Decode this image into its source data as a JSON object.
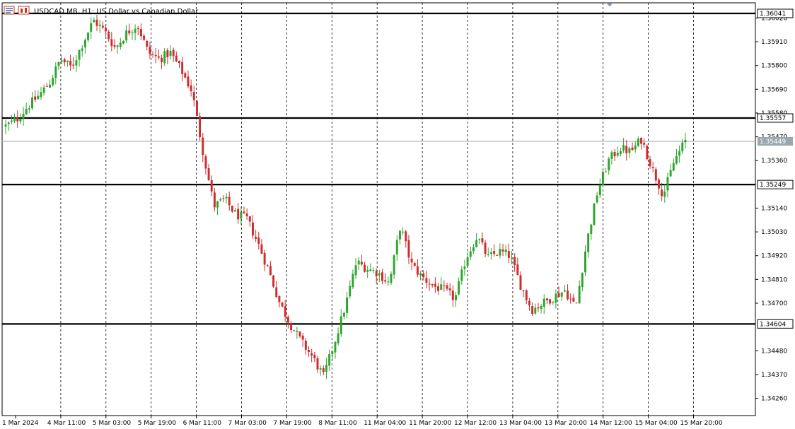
{
  "header": {
    "symbol_title": "USDCAD.MB, H1:  US Dollar vs Canadian Dollar",
    "icons": [
      "chart-type-icon",
      "indicator-icon"
    ]
  },
  "colors": {
    "bull": "#2ea52e",
    "bear": "#d12b2b",
    "grid": "#000000",
    "level_line": "#000000",
    "current_line": "#9aa7ad",
    "label_bg": "#ffffff",
    "current_label_bg": "#9aa7ad"
  },
  "chart_data": {
    "type": "candlestick",
    "title": "USDCAD.MB, H1:  US Dollar vs Canadian Dollar",
    "timeframe": "H1",
    "grid": "vertical-dashed",
    "ylim": [
      1.3418,
      1.3609
    ],
    "y_ticks": [
      1.3602,
      1.3591,
      1.358,
      1.3569,
      1.3558,
      1.3547,
      1.3536,
      1.3514,
      1.3503,
      1.3492,
      1.3481,
      1.347,
      1.3448,
      1.3437,
      1.3426
    ],
    "x_tick_labels": [
      "1 Mar 2024",
      "4 Mar 11:00",
      "5 Mar 03:00",
      "5 Mar 19:00",
      "6 Mar 11:00",
      "7 Mar 03:00",
      "7 Mar 19:00",
      "8 Mar 11:00",
      "11 Mar 04:00",
      "11 Mar 20:00",
      "12 Mar 12:00",
      "13 Mar 04:00",
      "13 Mar 20:00",
      "14 Mar 12:00",
      "15 Mar 04:00",
      "15 Mar 20:00"
    ],
    "horizontal_levels": [
      {
        "value": 1.36041,
        "label": "1.36041"
      },
      {
        "value": 1.35557,
        "label": "1.35557"
      },
      {
        "value": 1.35249,
        "label": "1.35249"
      },
      {
        "value": 1.34604,
        "label": "1.34604"
      }
    ],
    "current_price": {
      "value": 1.35449,
      "label": "1.35449"
    },
    "close_path": [
      1.3552,
      1.3555,
      1.3561,
      1.3566,
      1.3572,
      1.3583,
      1.3579,
      1.359,
      1.3601,
      1.3596,
      1.3588,
      1.3595,
      1.3599,
      1.3586,
      1.3583,
      1.3586,
      1.3578,
      1.3568,
      1.354,
      1.3515,
      1.3518,
      1.3511,
      1.3509,
      1.3498,
      1.3485,
      1.347,
      1.346,
      1.3452,
      1.3445,
      1.3436,
      1.3452,
      1.3469,
      1.3489,
      1.3486,
      1.3484,
      1.3479,
      1.3506,
      1.3488,
      1.3482,
      1.3478,
      1.3476,
      1.3472,
      1.3491,
      1.3501,
      1.3491,
      1.3494,
      1.3492,
      1.3478,
      1.3467,
      1.347,
      1.3473,
      1.3476,
      1.3468,
      1.3498,
      1.3522,
      1.3536,
      1.3542,
      1.354,
      1.3546,
      1.3532,
      1.352,
      1.3536,
      1.3545
    ]
  }
}
